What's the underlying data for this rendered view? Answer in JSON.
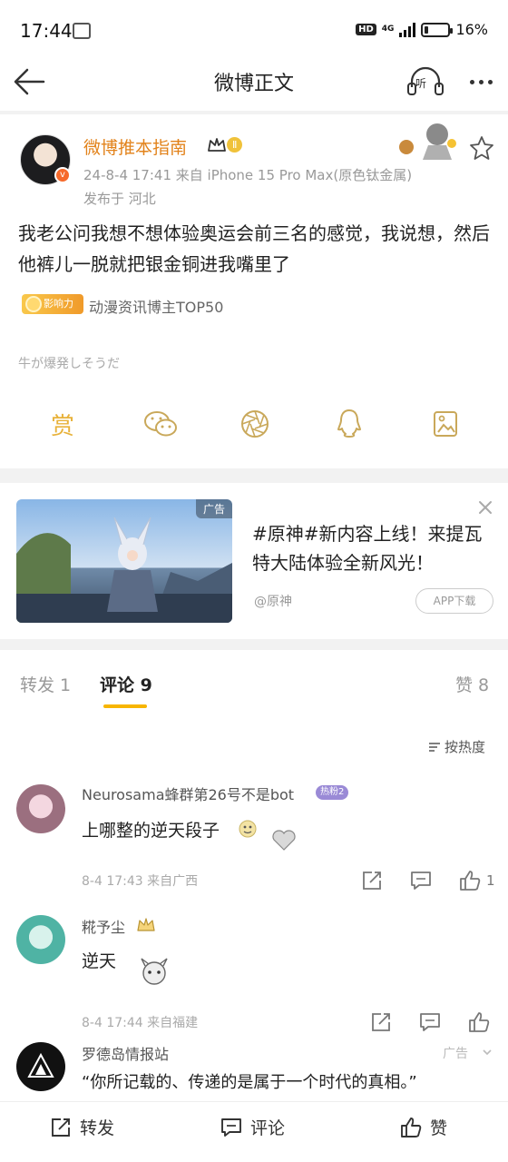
{
  "status_bar": {
    "time": "17:44",
    "hd": "HD",
    "network": "4G",
    "battery": "16%",
    "battery_level": 0.16
  },
  "nav": {
    "title": "微博正文",
    "listen_label": "听"
  },
  "post": {
    "author": "微博推本指南",
    "level_badge": "Ⅱ",
    "meta": "24-8-4 17:41  来自 iPhone 15 Pro Max(原色钛金属)",
    "location": "发布于 河北",
    "text": "我老公问我想不想体验奥运会前三名的感觉，我说想，然后他裤儿一脱就把银金铜进我嘴里了",
    "influence_badge": "影响力",
    "influence_label": "动漫资讯博主TOP50",
    "source_tag": "牛が爆発しそうだ",
    "share": {
      "reward": "赏"
    }
  },
  "ad": {
    "image_tag": "广告",
    "title": "#原神#新内容上线！来提瓦特大陆体验全新风光！",
    "source": "@原神",
    "button": "APP下载"
  },
  "tabs": {
    "repost": "转发 1",
    "comment": "评论 9",
    "like": "赞 8",
    "sort": "按热度"
  },
  "comments": [
    {
      "name": "Neurosama蜂群第26号不是bot",
      "badge": "热粉2",
      "text": "上哪整的逆天段子",
      "meta": "8-4 17:43  来自广西",
      "likes": "1"
    },
    {
      "name": "糀予尘",
      "text": "逆天",
      "meta": "8-4 17:44  来自福建"
    },
    {
      "name": "罗德岛情报站",
      "ad_tag": "广告",
      "text": "“你所记载的、传递的是属于一个时代的真相。”"
    }
  ],
  "bottom_bar": {
    "repost": "转发",
    "comment": "评论",
    "like": "赞"
  },
  "colors": {
    "accent": "#f7b500",
    "vip_name": "#e2821a"
  }
}
